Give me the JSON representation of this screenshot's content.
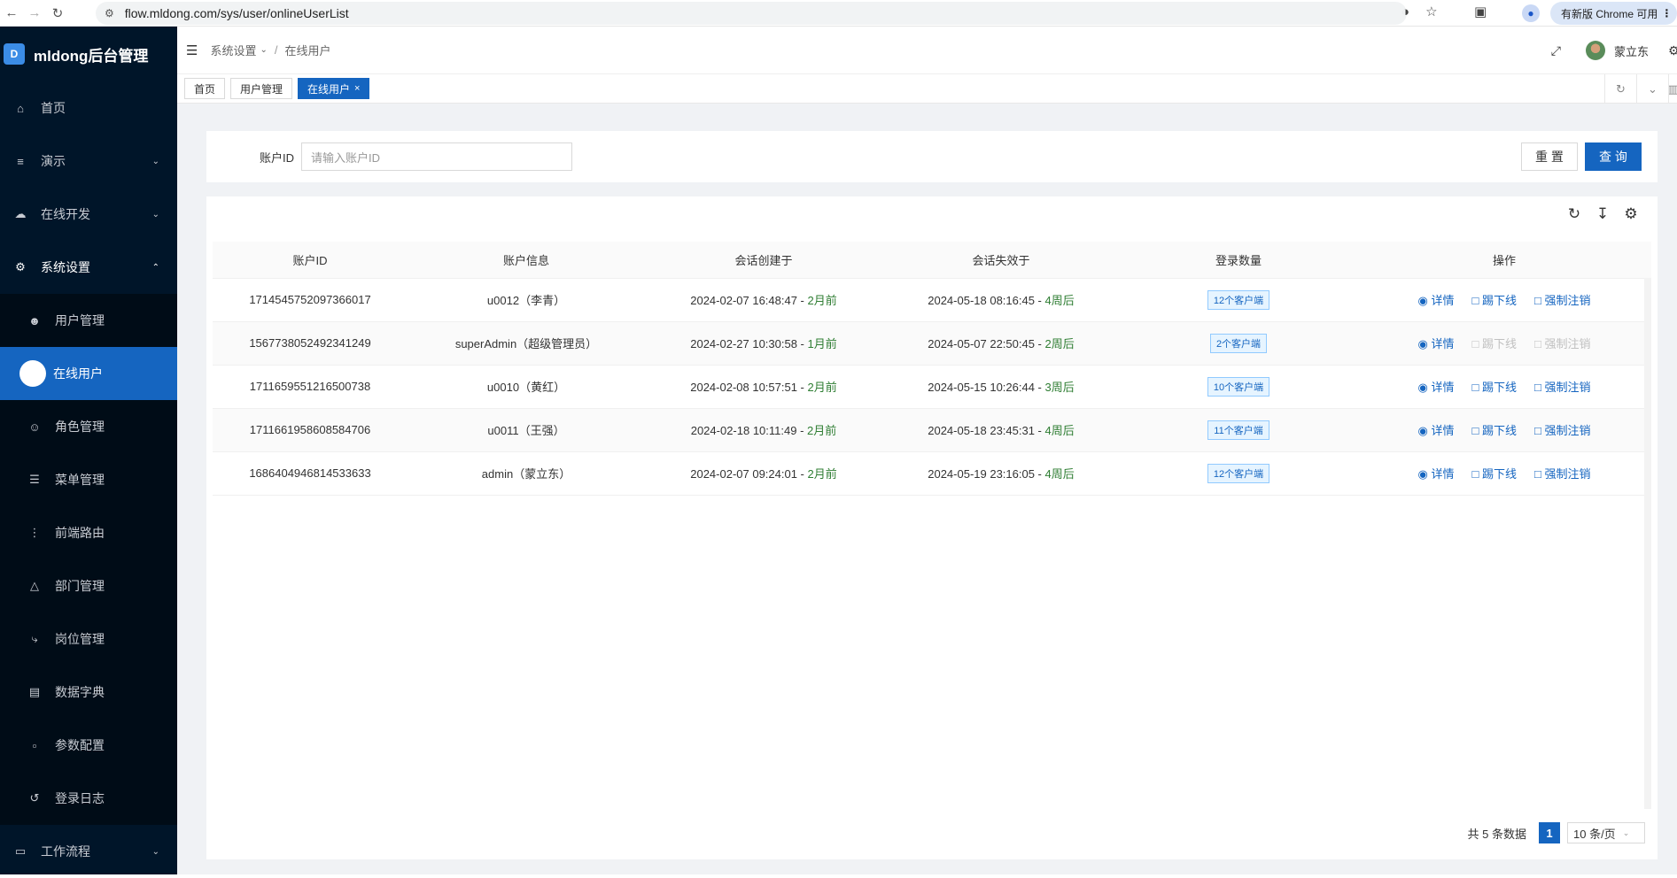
{
  "browser": {
    "url": "flow.mldong.com/sys/user/onlineUserList",
    "update_label": "有新版 Chrome 可用"
  },
  "sidebar": {
    "logo_text": "mldong后台管理",
    "items": [
      {
        "label": "首页",
        "icon": "home-icon"
      },
      {
        "label": "演示",
        "icon": "list-icon"
      },
      {
        "label": "在线开发",
        "icon": "cloud-icon"
      },
      {
        "label": "系统设置",
        "icon": "gear-icon"
      }
    ],
    "sub_items": [
      {
        "label": "用户管理",
        "icon": "user-icon"
      },
      {
        "label": "在线用户",
        "icon": "dot-icon"
      },
      {
        "label": "角色管理",
        "icon": "role-icon"
      },
      {
        "label": "菜单管理",
        "icon": "menu-icon"
      },
      {
        "label": "前端路由",
        "icon": "route-icon"
      },
      {
        "label": "部门管理",
        "icon": "dept-icon"
      },
      {
        "label": "岗位管理",
        "icon": "share-icon"
      },
      {
        "label": "数据字典",
        "icon": "book-icon"
      },
      {
        "label": "参数配置",
        "icon": "file-icon"
      },
      {
        "label": "登录日志",
        "icon": "log-icon"
      }
    ],
    "workflow_label": "工作流程"
  },
  "header": {
    "breadcrumb_parent": "系统设置",
    "breadcrumb_current": "在线用户",
    "user_name": "蒙立东"
  },
  "tabs": [
    {
      "label": "首页"
    },
    {
      "label": "用户管理"
    },
    {
      "label": "在线用户"
    }
  ],
  "search": {
    "label": "账户ID",
    "placeholder": "请输入账户ID",
    "reset_label": "重 置",
    "query_label": "查 询"
  },
  "table": {
    "columns": [
      "账户ID",
      "账户信息",
      "会话创建于",
      "会话失效于",
      "登录数量",
      "操作"
    ],
    "rows": [
      {
        "id": "1714545752097366017",
        "info": "u0012（李青）",
        "created": "2024-02-07 16:48:47 - ",
        "created_ago": "2月前",
        "expires": "2024-05-18 08:16:45 - ",
        "expires_rel": "4周后",
        "count": "12个客户端",
        "actions_enabled": true
      },
      {
        "id": "1567738052492341249",
        "info": "superAdmin（超级管理员）",
        "created": "2024-02-27 10:30:58 - ",
        "created_ago": "1月前",
        "expires": "2024-05-07 22:50:45 - ",
        "expires_rel": "2周后",
        "count": "2个客户端",
        "actions_enabled": false
      },
      {
        "id": "1711659551216500738",
        "info": "u0010（黄红）",
        "created": "2024-02-08 10:57:51 - ",
        "created_ago": "2月前",
        "expires": "2024-05-15 10:26:44 - ",
        "expires_rel": "3周后",
        "count": "10个客户端",
        "actions_enabled": true
      },
      {
        "id": "1711661958608584706",
        "info": "u0011（王强）",
        "created": "2024-02-18 10:11:49 - ",
        "created_ago": "2月前",
        "expires": "2024-05-18 23:45:31 - ",
        "expires_rel": "4周后",
        "count": "11个客户端",
        "actions_enabled": true
      },
      {
        "id": "1686404946814533633",
        "info": "admin（蒙立东）",
        "created": "2024-02-07 09:24:01 - ",
        "created_ago": "2月前",
        "expires": "2024-05-19 23:16:05 - ",
        "expires_rel": "4周后",
        "count": "12个客户端",
        "actions_enabled": true
      }
    ],
    "action_labels": {
      "detail": "详情",
      "kick": "踢下线",
      "force": "强制注销"
    }
  },
  "pagination": {
    "total_text": "共 5 条数据",
    "current_page": "1",
    "page_size": "10 条/页"
  }
}
